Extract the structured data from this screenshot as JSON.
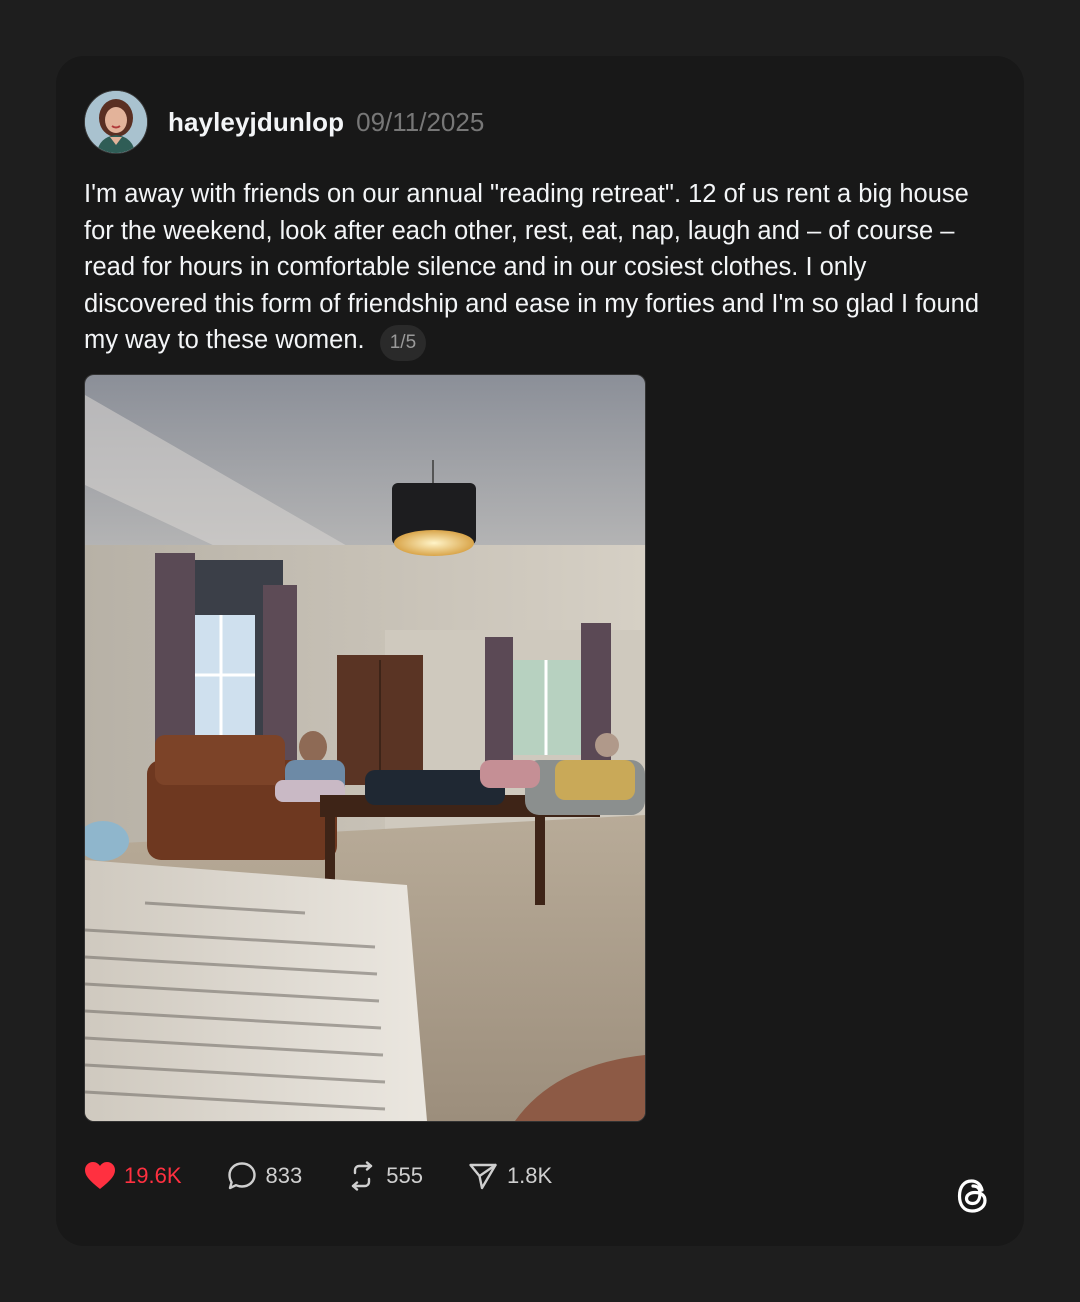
{
  "post": {
    "username": "hayleyjdunlop",
    "date": "09/11/2025",
    "text": "I'm away with friends on our annual \"reading retreat\". 12 of us rent a big house for the weekend, look after each other, rest, eat, nap, laugh and – of course – read for hours in comfortable silence and in our cosiest clothes. I only discovered this form of friendship and ease in my forties and I'm so glad I found my way to these women.",
    "media_counter": "1/5"
  },
  "actions": {
    "likes": "19.6K",
    "replies": "833",
    "reposts": "555",
    "shares": "1.8K"
  },
  "icons": {
    "like": "heart-icon",
    "reply": "speech-bubble-icon",
    "repost": "repost-arrows-icon",
    "share": "paper-plane-icon",
    "brand": "threads-logo-icon"
  },
  "colors": {
    "background": "#1e1e1e",
    "card": "#181818",
    "like_active": "#ff3040",
    "muted": "#777777"
  }
}
